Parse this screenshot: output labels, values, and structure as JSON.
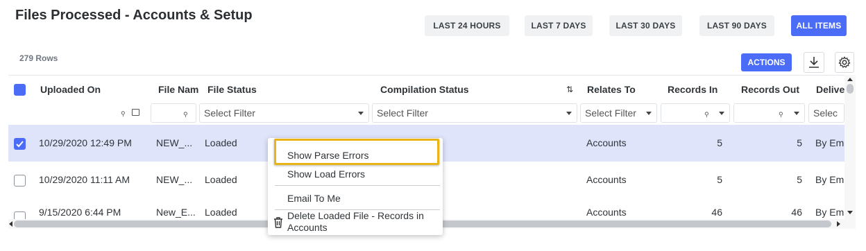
{
  "page": {
    "title": "Files Processed - Accounts & Setup"
  },
  "ranges": [
    {
      "label": "LAST 24 HOURS",
      "active": false
    },
    {
      "label": "LAST 7 DAYS",
      "active": false
    },
    {
      "label": "LAST 30 DAYS",
      "active": false
    },
    {
      "label": "LAST 90 DAYS",
      "active": false
    },
    {
      "label": "ALL ITEMS",
      "active": true
    }
  ],
  "toolbar": {
    "rows_label": "279 Rows",
    "actions_label": "ACTIONS"
  },
  "columns": {
    "uploaded_on": "Uploaded On",
    "file_name": "File Nam",
    "file_status": "File Status",
    "compilation_status": "Compilation Status",
    "relates_to": "Relates To",
    "records_in": "Records In",
    "records_out": "Records Out",
    "delivery": "Delive"
  },
  "filters": {
    "file_status_placeholder": "Select Filter",
    "compilation_status_placeholder": "Select Filter",
    "relates_to_placeholder": "Select Filter",
    "delivery_placeholder": "Selec"
  },
  "rows": [
    {
      "selected": true,
      "uploaded_on": "10/29/2020 12:49 PM",
      "file_name": "NEW_...",
      "file_status": "Loaded",
      "relates_to": "Accounts",
      "records_in": "5",
      "records_out": "5",
      "delivery": "By Em"
    },
    {
      "selected": false,
      "uploaded_on": "10/29/2020 11:11 AM",
      "file_name": "NEW_...",
      "file_status": "Loaded",
      "relates_to": "Accounts",
      "records_in": "5",
      "records_out": "5",
      "delivery": "By Em"
    },
    {
      "selected": false,
      "uploaded_on": "9/15/2020 6:44 PM",
      "file_name": "New_E...",
      "file_status": "Loaded",
      "relates_to": "Accounts",
      "records_in": "46",
      "records_out": "46",
      "delivery": "By Em"
    }
  ],
  "context_menu": {
    "items": [
      {
        "label": "Show Parse Errors"
      },
      {
        "label": "Show Load Errors"
      },
      {
        "label": "Email To Me"
      },
      {
        "label_line1": "Delete Loaded File - Records in",
        "label_line2": "Accounts"
      }
    ]
  },
  "colors": {
    "accent": "#4a6cf7",
    "highlight": "#e8b418",
    "selected_row": "#dfe4fb"
  }
}
